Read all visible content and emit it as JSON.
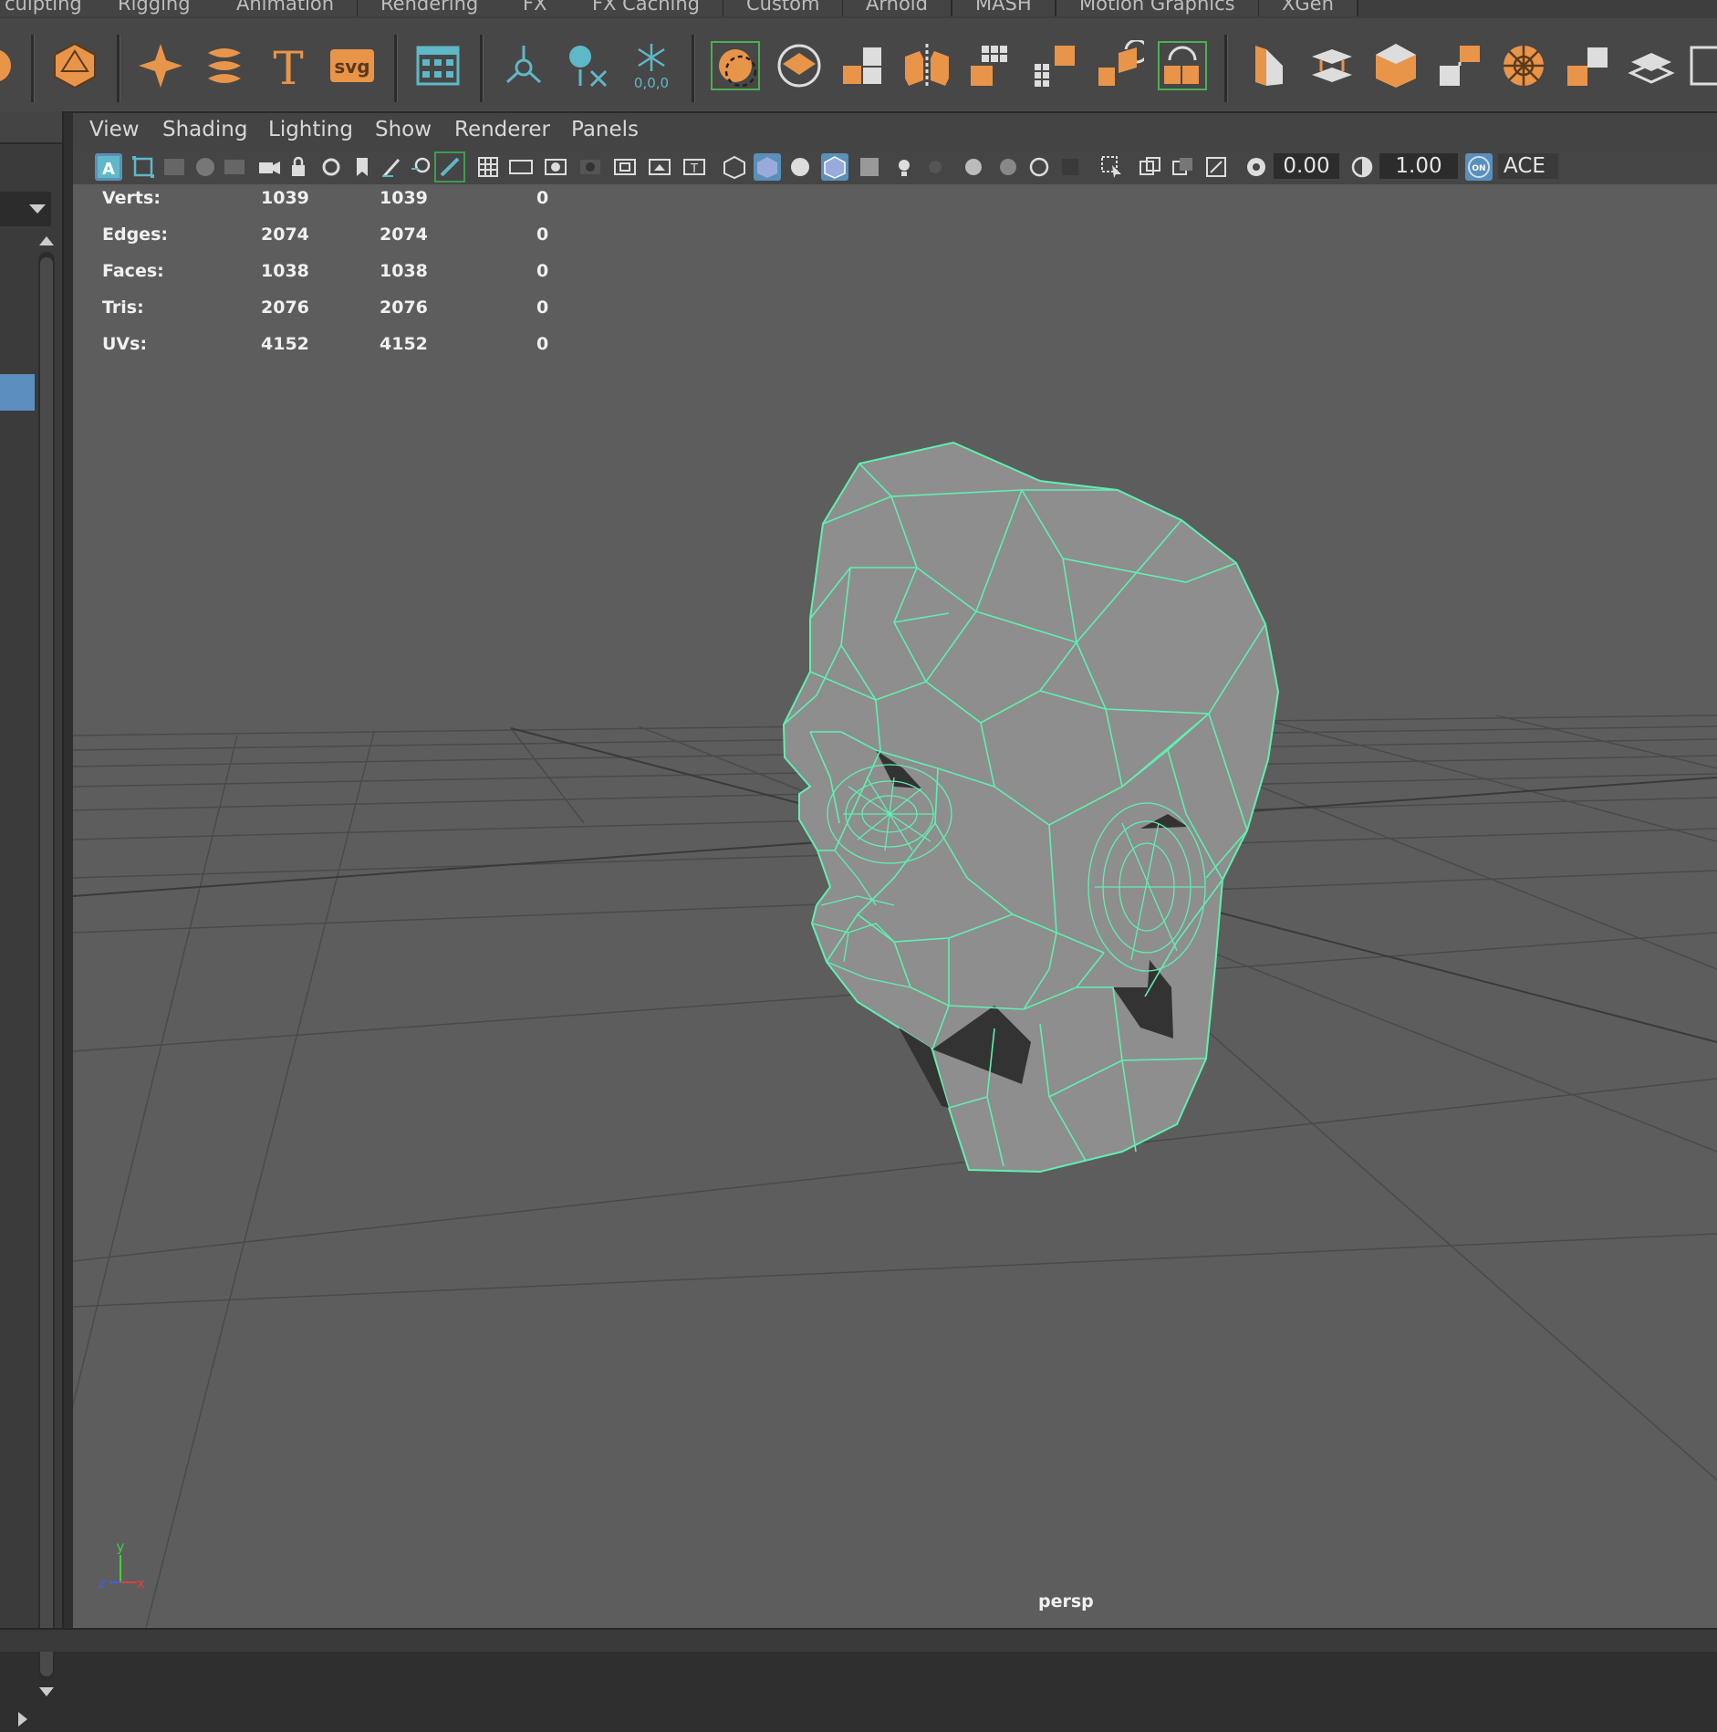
{
  "shelf_tabs": [
    "culpting",
    "Rigging",
    "Animation",
    "Rendering",
    "FX",
    "FX Caching",
    "Custom",
    "Arnold",
    "MASH",
    "Motion Graphics",
    "XGen"
  ],
  "shelf": {
    "svg_label": "svg",
    "zero_label": "0,0,0"
  },
  "panel_menu": [
    "View",
    "Shading",
    "Lighting",
    "Show",
    "Renderer",
    "Panels"
  ],
  "toolbar": {
    "exposure": "0.00",
    "gamma": "1.00",
    "on_label": "ON",
    "color_space": "ACE"
  },
  "hud": {
    "rows": [
      {
        "label": "Verts:",
        "a": "1039",
        "b": "1039",
        "c": "0"
      },
      {
        "label": "Edges:",
        "a": "2074",
        "b": "2074",
        "c": "0"
      },
      {
        "label": "Faces:",
        "a": "1038",
        "b": "1038",
        "c": "0"
      },
      {
        "label": "Tris:",
        "a": "2076",
        "b": "2076",
        "c": "0"
      },
      {
        "label": "UVs:",
        "a": "4152",
        "b": "4152",
        "c": "0"
      }
    ]
  },
  "camera": "persp",
  "axis": {
    "y": "y",
    "z": "z",
    "x": "x"
  },
  "colors": {
    "accent_orange": "#e8954a",
    "accent_teal": "#5fb8c7",
    "wireframe": "#5ff0b0",
    "mesh": "#8e8e8e",
    "viewport_bg": "#5d5d5d"
  }
}
